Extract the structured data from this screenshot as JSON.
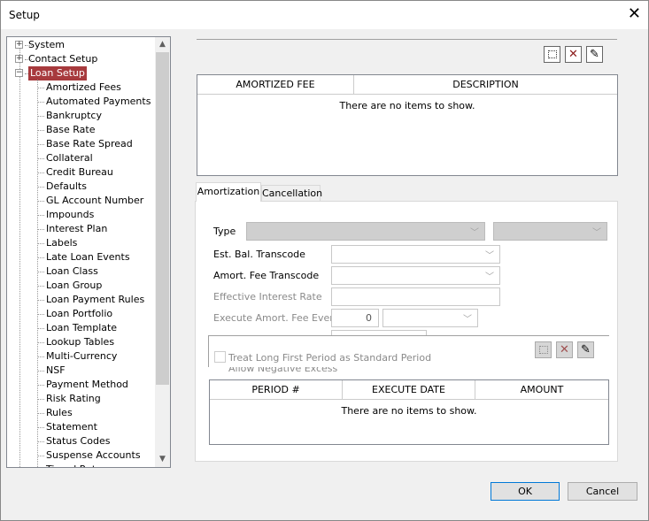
{
  "window": {
    "title": "Setup"
  },
  "tree": {
    "items": [
      {
        "label": "System",
        "level": 0,
        "expander": "+"
      },
      {
        "label": "Contact Setup",
        "level": 0,
        "expander": "+"
      },
      {
        "label": "Loan Setup",
        "level": 0,
        "expander": "-",
        "selected": true
      },
      {
        "label": "Amortized Fees",
        "level": 1
      },
      {
        "label": "Automated Payments",
        "level": 1
      },
      {
        "label": "Bankruptcy",
        "level": 1
      },
      {
        "label": "Base Rate",
        "level": 1
      },
      {
        "label": "Base Rate Spread",
        "level": 1
      },
      {
        "label": "Collateral",
        "level": 1
      },
      {
        "label": "Credit Bureau",
        "level": 1
      },
      {
        "label": "Defaults",
        "level": 1
      },
      {
        "label": "GL Account Number",
        "level": 1
      },
      {
        "label": "Impounds",
        "level": 1
      },
      {
        "label": "Interest Plan",
        "level": 1
      },
      {
        "label": "Labels",
        "level": 1
      },
      {
        "label": "Late Loan Events",
        "level": 1
      },
      {
        "label": "Loan Class",
        "level": 1
      },
      {
        "label": "Loan Group",
        "level": 1
      },
      {
        "label": "Loan Payment Rules",
        "level": 1
      },
      {
        "label": "Loan Portfolio",
        "level": 1
      },
      {
        "label": "Loan Template",
        "level": 1
      },
      {
        "label": "Lookup Tables",
        "level": 1
      },
      {
        "label": "Multi-Currency",
        "level": 1
      },
      {
        "label": "NSF",
        "level": 1
      },
      {
        "label": "Payment Method",
        "level": 1
      },
      {
        "label": "Risk Rating",
        "level": 1
      },
      {
        "label": "Rules",
        "level": 1
      },
      {
        "label": "Statement",
        "level": 1
      },
      {
        "label": "Status Codes",
        "level": 1
      },
      {
        "label": "Suspense Accounts",
        "level": 1
      },
      {
        "label": "Tiered Rates",
        "level": 1
      }
    ]
  },
  "fees_grid": {
    "columns": [
      "AMORTIZED FEE",
      "DESCRIPTION"
    ],
    "empty_text": "There are no items to show."
  },
  "toolbar": {
    "icons": [
      "new-icon",
      "delete-icon",
      "edit-icon"
    ]
  },
  "tabs": [
    {
      "label": "Amortization",
      "active": true
    },
    {
      "label": "Cancellation"
    }
  ],
  "form": {
    "type_label": "Type",
    "est_bal_label": "Est. Bal. Transcode",
    "amort_fee_label": "Amort. Fee Transcode",
    "eff_rate_label": "Effective Interest Rate",
    "execute_label": "Execute Amort. Fee Every",
    "execute_value": "0",
    "treat_long_label": "Treat Long First Period as Standard Period",
    "allow_negative_label": "Allow Negative Excess"
  },
  "period_grid": {
    "columns": [
      "PERIOD #",
      "EXECUTE DATE",
      "AMOUNT"
    ],
    "empty_text": "There are no items to show."
  },
  "buttons": {
    "ok": "OK",
    "cancel": "Cancel"
  },
  "colors": {
    "selection": "#a73a3d",
    "delete": "#8b1a1a"
  }
}
